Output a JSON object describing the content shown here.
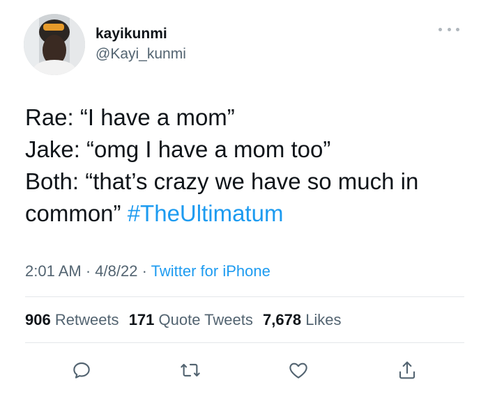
{
  "tweet": {
    "display_name": "kayikunmi",
    "handle": "@Kayi_kunmi",
    "lines": [
      "Rae: “I have a mom”",
      "Jake: “omg I have a mom too”",
      "Both: “that’s crazy we have so much in",
      "common”"
    ],
    "hashtag": "#TheUltimatum",
    "time": "2:01 AM",
    "date": "4/8/22",
    "separator": "·",
    "source": "Twitter for iPhone"
  },
  "stats": {
    "retweets_count": "906",
    "retweets_label": "Retweets",
    "quotes_count": "171",
    "quotes_label": "Quote Tweets",
    "likes_count": "7,678",
    "likes_label": "Likes"
  },
  "icons": {
    "more": "more-horizontal-icon",
    "reply": "reply-icon",
    "retweet": "retweet-icon",
    "like": "heart-icon",
    "share": "share-icon"
  },
  "colors": {
    "text": "#0f1419",
    "secondary": "#536471",
    "link": "#1d9bf0",
    "divider": "#e4e7ea"
  }
}
